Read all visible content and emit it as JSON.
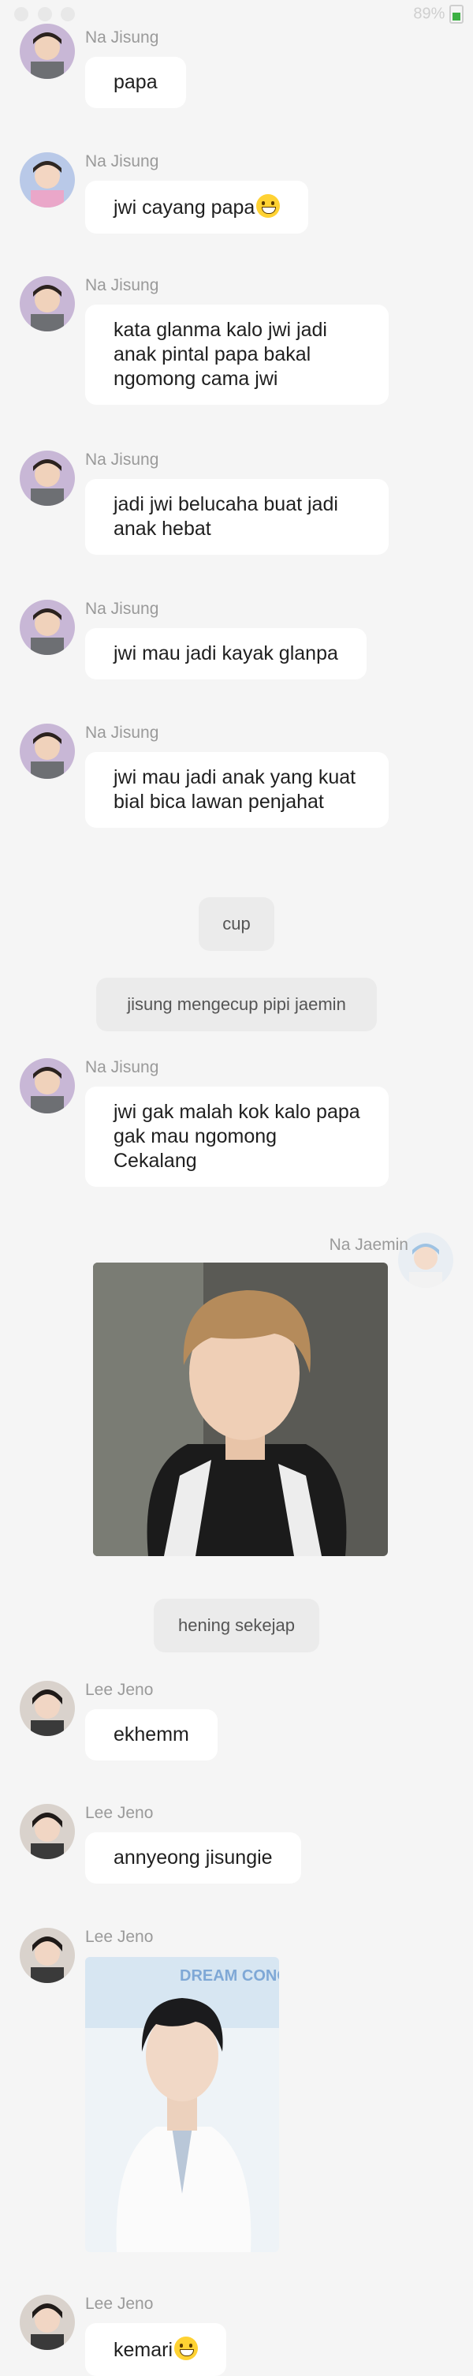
{
  "status_bar": {
    "right_text": "89%"
  },
  "senders": {
    "jisung": "Na Jisung",
    "jaemin": "Na Jaemin",
    "jeno": "Lee Jeno"
  },
  "messages": [
    "papa",
    "jwi cayang papa",
    "kata glanma kalo jwi jadi anak pintal papa bakal ngomong cama jwi",
    "jadi jwi belucaha buat jadi anak hebat",
    "jwi mau jadi kayak glanpa",
    "jwi mau jadi anak yang kuat bial bica lawan penjahat",
    "jwi gak malah kok kalo papa gak mau ngomong Cekalang",
    "ekhemm",
    "annyeong jisungie",
    "kemari"
  ],
  "narrations": [
    "cup",
    "jisung mengecup pipi jaemin",
    "hening sekejap"
  ],
  "photos": {
    "jaemin": {
      "label": ""
    },
    "jeno": {
      "banner_text": "DREAM CONCERT"
    }
  },
  "icons": {
    "emoji": "grinning-face-icon",
    "battery": "battery-icon"
  }
}
